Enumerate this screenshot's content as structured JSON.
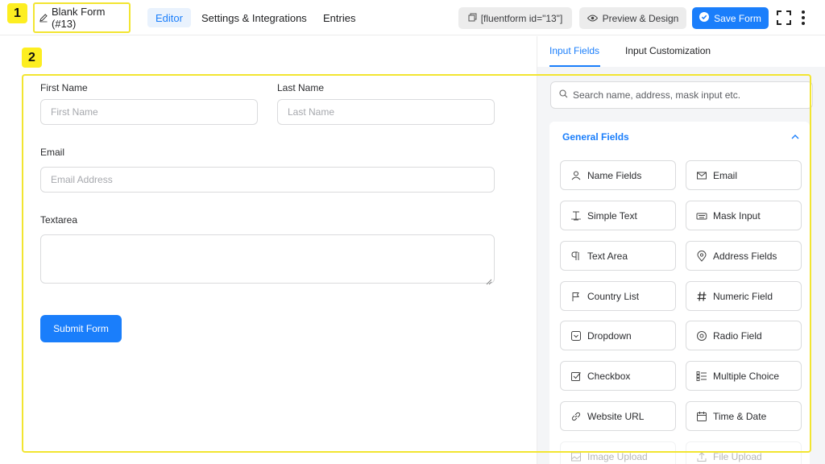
{
  "badges": {
    "one": "1",
    "two": "2"
  },
  "header": {
    "form_title": "Blank Form (#13)",
    "tabs": [
      "Editor",
      "Settings & Integrations",
      "Entries"
    ],
    "shortcode": "[fluentform id=\"13\"]",
    "preview_label": "Preview & Design",
    "save_label": "Save Form"
  },
  "form": {
    "first_name": {
      "label": "First Name",
      "placeholder": "First Name"
    },
    "last_name": {
      "label": "Last Name",
      "placeholder": "Last Name"
    },
    "email": {
      "label": "Email",
      "placeholder": "Email Address"
    },
    "textarea": {
      "label": "Textarea"
    },
    "submit_label": "Submit Form"
  },
  "sidebar": {
    "tabs": [
      "Input Fields",
      "Input Customization"
    ],
    "search_placeholder": "Search name, address, mask input etc.",
    "group_title": "General Fields",
    "fields": [
      {
        "label": "Name Fields",
        "icon": "user-icon"
      },
      {
        "label": "Email",
        "icon": "envelope-icon"
      },
      {
        "label": "Simple Text",
        "icon": "text-cursor-icon"
      },
      {
        "label": "Mask Input",
        "icon": "keyboard-icon"
      },
      {
        "label": "Text Area",
        "icon": "paragraph-icon"
      },
      {
        "label": "Address Fields",
        "icon": "map-pin-icon"
      },
      {
        "label": "Country List",
        "icon": "flag-icon"
      },
      {
        "label": "Numeric Field",
        "icon": "hash-icon"
      },
      {
        "label": "Dropdown",
        "icon": "dropdown-icon"
      },
      {
        "label": "Radio Field",
        "icon": "radio-icon"
      },
      {
        "label": "Checkbox",
        "icon": "checkbox-icon"
      },
      {
        "label": "Multiple Choice",
        "icon": "list-icon"
      },
      {
        "label": "Website URL",
        "icon": "link-icon"
      },
      {
        "label": "Time & Date",
        "icon": "calendar-icon"
      },
      {
        "label": "Image Upload",
        "icon": "image-icon"
      },
      {
        "label": "File Upload",
        "icon": "upload-icon"
      }
    ]
  },
  "colors": {
    "accent": "#1a7efb",
    "highlight": "#f2e531",
    "badge": "#fdee21"
  }
}
